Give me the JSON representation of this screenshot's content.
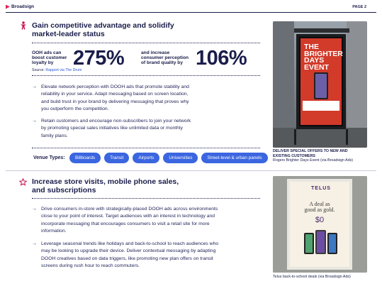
{
  "header": {
    "brand": "Broadsign",
    "page": "PAGE 2"
  },
  "section1": {
    "title_line1": "Gain competitive advantage and solidify",
    "title_line2": "market-leader status",
    "stat1": {
      "label_lines": [
        "OOH ads can",
        "boost customer",
        "loyalty by"
      ],
      "value": "275%"
    },
    "stat2": {
      "label_lines": [
        "and increase",
        "consumer perception",
        "of brand quality by"
      ],
      "value": "106%"
    },
    "source_label": "Source:",
    "source_link": "Rapport via The Drum",
    "bullets": [
      [
        "Elevate network perception with DOOH ads that promote stability and",
        "reliability in your service. Adapt messaging based on screen location,",
        "and build trust in your brand by delivering messaging that proves why",
        "you outperform the competition."
      ],
      [
        "Retain customers and encourage non-subscribers to join your network",
        "by promoting special sales initiatives like unlimited data or monthly",
        "family plans."
      ]
    ],
    "venue_label": "Venue Types:",
    "venues": [
      "Billboards",
      "Transit",
      "Airports",
      "Universities",
      "Street-level & urban panels"
    ],
    "photo": {
      "poster_lines": [
        "THE",
        "BRIGHTER",
        "DAYS",
        "EVENT"
      ],
      "caption_bold": [
        "DELIVER SPECIAL OFFERS TO NEW AND",
        "EXISTING CUSTOMERS"
      ],
      "caption": "Rogers Brighter Days Event (via Broadsign Ads)"
    }
  },
  "section2": {
    "title_line1": "Increase store visits, mobile phone sales,",
    "title_line2": "and subscriptions",
    "bullets": [
      [
        "Drive consumers in-store with strategically-placed DOOH ads across environments",
        "close to your point of interest. Target audiences with an interest in technology and",
        "incorporate messaging that encourages consumers to visit a retail site for more",
        "information."
      ],
      [
        "Leverage seasonal trends like holidays and back-to-school to reach audiences who",
        "may be looking to upgrade their device. Deliver contextual messaging by adapting",
        "DOOH creatives based on data triggers, like promoting new plan offers on transit",
        "screens during rush hour to reach commuters."
      ]
    ],
    "photo": {
      "brand": "TELUS",
      "poster_lines": [
        "A deal as",
        "good as gold."
      ],
      "price": "$0",
      "caption": "Telus back-to-school deals (via Broadsign Ads)"
    }
  },
  "colors": {
    "navy": "#1a1d4a",
    "accent": "#c8154f",
    "pill": "#3b66e0",
    "link": "#2a55d6"
  }
}
